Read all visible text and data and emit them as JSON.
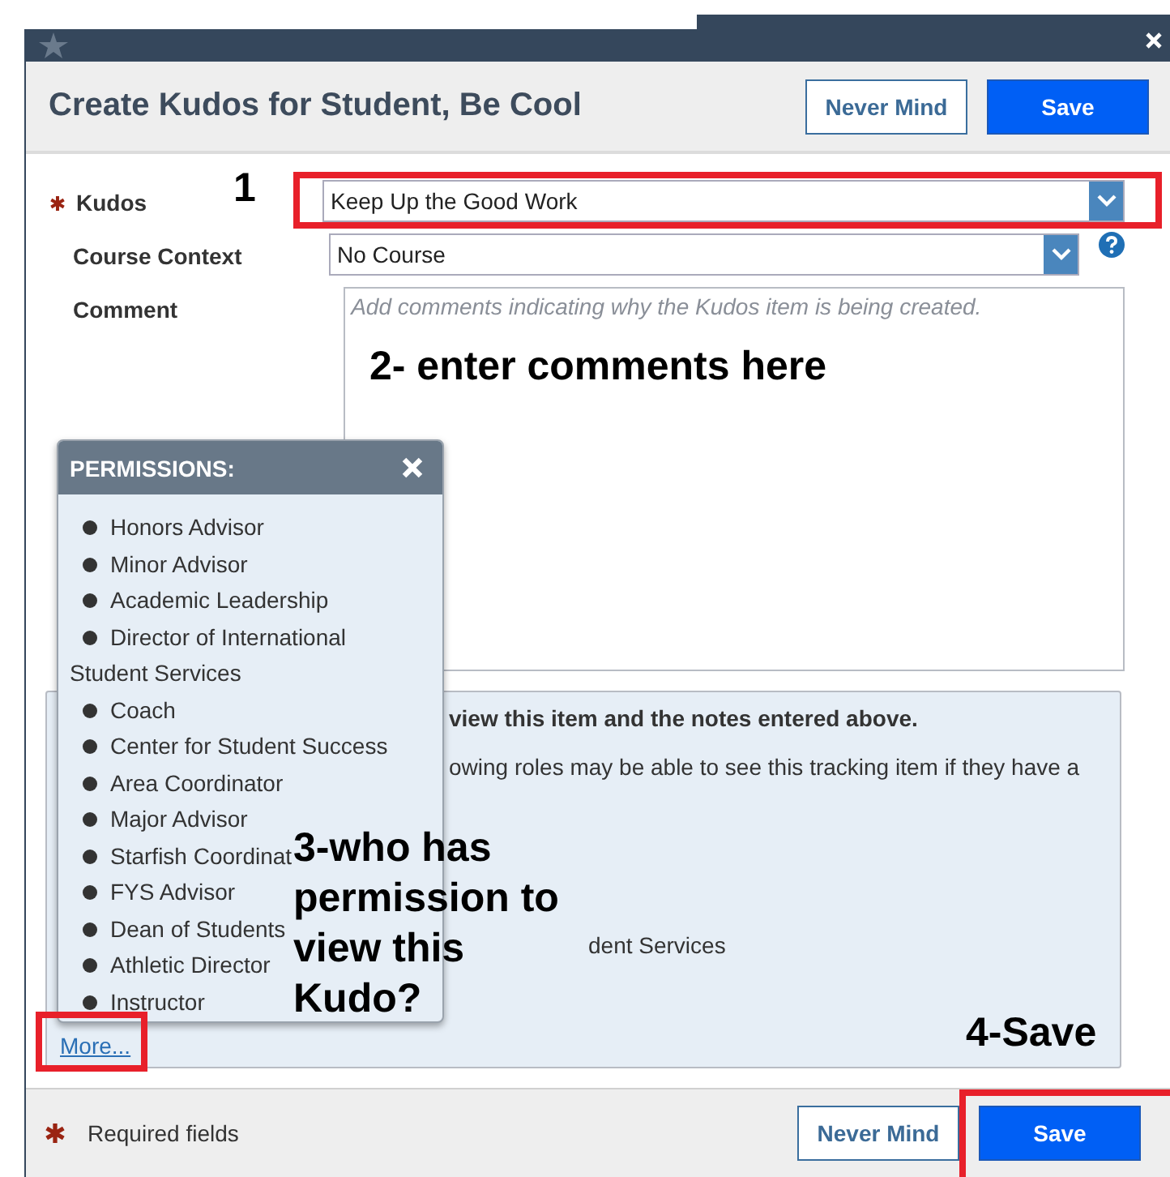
{
  "header": {
    "title": "Create Kudos for Student, Be Cool",
    "buttons": [
      {
        "label": "Never Mind",
        "kind": "secondary"
      },
      {
        "label": "Save",
        "kind": "primary"
      }
    ]
  },
  "form": {
    "fields": [
      {
        "label": "Kudos",
        "required": true,
        "kind": "select",
        "value": "Keep Up the Good Work",
        "help": false
      },
      {
        "label": "Course Context",
        "required": false,
        "kind": "select",
        "value": "No Course",
        "help": true
      },
      {
        "label": "Comment",
        "required": false,
        "kind": "textarea",
        "placeholder": "Add comments indicating why the Kudos item is being created."
      }
    ]
  },
  "permissions_panel": {
    "lines": [
      {
        "text": "view this item and the notes entered above.",
        "kind": "heading"
      },
      {
        "text": "owing roles may be able to see this tracking item if they have a",
        "kind": "body"
      },
      {
        "text": "dent Services",
        "kind": "body"
      }
    ],
    "more_link": "More..."
  },
  "permissions_popup": {
    "title": "PERMISSIONS:",
    "items": [
      "Honors Advisor",
      "Minor Advisor",
      "Academic Leadership",
      "Director of International Student Services",
      "Coach",
      "Center for Student Success",
      "Area Coordinator",
      "Major Advisor",
      "Starfish Coordinat",
      "FYS Advisor",
      "Dean of Students",
      "Athletic Director",
      "Instructor"
    ]
  },
  "footer": {
    "required_note": "Required fields",
    "buttons": [
      {
        "label": "Never Mind",
        "kind": "secondary"
      },
      {
        "label": "Save",
        "kind": "primary"
      }
    ]
  },
  "annotations": [
    {
      "text": "1"
    },
    {
      "text": "2- enter comments here"
    },
    {
      "text": "3-who has permission to view this Kudo?"
    },
    {
      "text": "4-Save"
    }
  ]
}
